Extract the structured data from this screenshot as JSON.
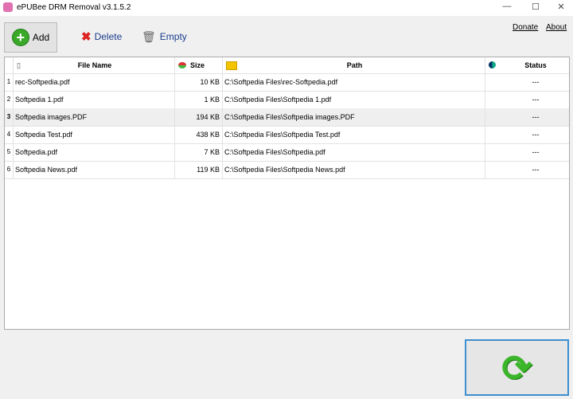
{
  "window": {
    "title": "ePUBee DRM Removal v3.1.5.2",
    "minimize": "—",
    "maximize": "☐",
    "close": "✕"
  },
  "toolbar": {
    "add": "Add",
    "delete": "Delete",
    "empty": "Empty"
  },
  "links": {
    "donate": "Donate",
    "about": "About"
  },
  "table": {
    "headers": {
      "file_name": "File Name",
      "size": "Size",
      "path": "Path",
      "status": "Status"
    },
    "rows": [
      {
        "index": "1",
        "file_name": "rec-Softpedia.pdf",
        "size": "10 KB",
        "path": "C:\\Softpedia Files\\rec-Softpedia.pdf",
        "status": "---"
      },
      {
        "index": "2",
        "file_name": "Softpedia 1.pdf",
        "size": "1 KB",
        "path": "C:\\Softpedia Files\\Softpedia 1.pdf",
        "status": "---"
      },
      {
        "index": "3",
        "file_name": "Softpedia images.PDF",
        "size": "194 KB",
        "path": "C:\\Softpedia Files\\Softpedia images.PDF",
        "status": "---"
      },
      {
        "index": "4",
        "file_name": "Softpedia Test.pdf",
        "size": "438 KB",
        "path": "C:\\Softpedia Files\\Softpedia Test.pdf",
        "status": "---"
      },
      {
        "index": "5",
        "file_name": "Softpedia.pdf",
        "size": "7 KB",
        "path": "C:\\Softpedia Files\\Softpedia.pdf",
        "status": "---"
      },
      {
        "index": "6",
        "file_name": "Softpedia News.pdf",
        "size": "119 KB",
        "path": "C:\\Softpedia Files\\Softpedia News.pdf",
        "status": "---"
      }
    ]
  },
  "convert_icon": "refresh-arrows-icon"
}
